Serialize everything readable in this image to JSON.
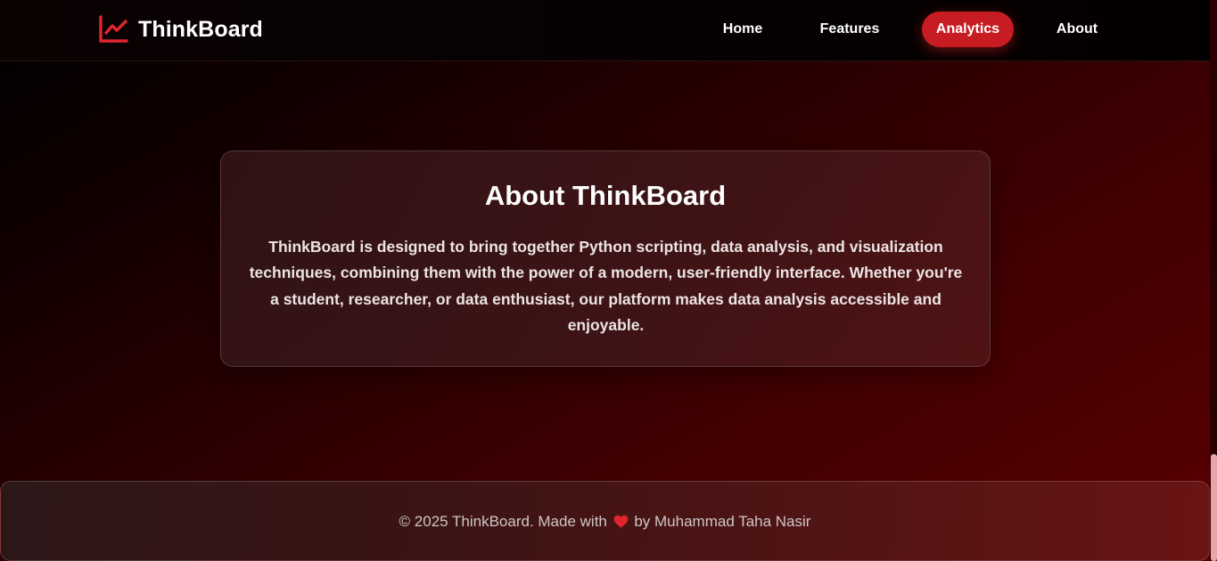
{
  "navbar": {
    "brand": {
      "name": "ThinkBoard",
      "icon": "chart-line-icon",
      "icon_color": "#e0262c"
    },
    "links": [
      {
        "label": "Home",
        "active": false
      },
      {
        "label": "Features",
        "active": false
      },
      {
        "label": "Analytics",
        "active": true
      },
      {
        "label": "About",
        "active": false
      }
    ]
  },
  "about": {
    "title": "About ThinkBoard",
    "body": "ThinkBoard is designed to bring together Python scripting, data analysis, and visualization techniques, combining them with the power of a modern, user-friendly interface. Whether you're a student, researcher, or data enthusiast, our platform makes data analysis accessible and enjoyable."
  },
  "footer": {
    "prefix": "© 2025 ThinkBoard. Made with",
    "icon": "heart-icon",
    "suffix": "by Muhammad Taha Nasir"
  },
  "colors": {
    "accent": "#c71d22",
    "heart": "#e0262c"
  }
}
